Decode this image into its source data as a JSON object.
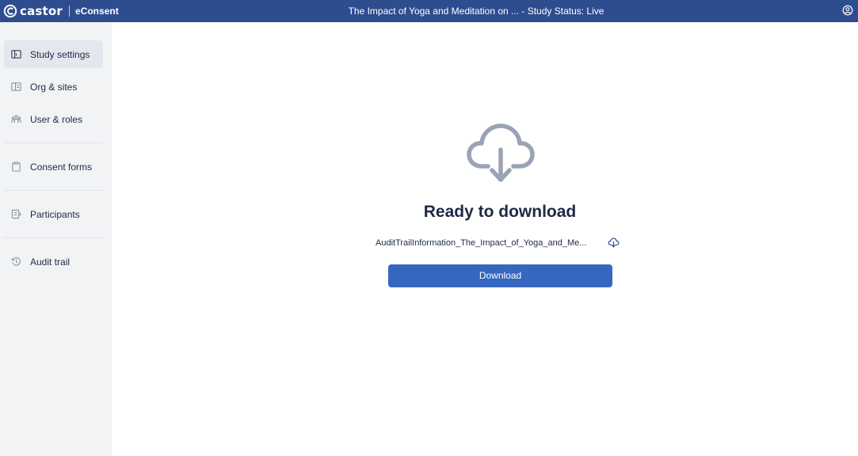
{
  "topbar": {
    "brand_name": "castor",
    "product_name": "eConsent",
    "title": "The Impact of Yoga and Meditation on ...  - Study Status: Live",
    "account_icon": "account-circle-icon"
  },
  "sidebar": {
    "items": [
      {
        "label": "Study settings",
        "icon": "settings-panel-icon",
        "active": true
      },
      {
        "label": "Org & sites",
        "icon": "building-icon",
        "active": false
      },
      {
        "label": "User & roles",
        "icon": "users-icon",
        "active": false
      },
      {
        "label": "Consent forms",
        "icon": "clipboard-icon",
        "active": false
      },
      {
        "label": "Participants",
        "icon": "participants-icon",
        "active": false
      },
      {
        "label": "Audit trail",
        "icon": "history-icon",
        "active": false
      }
    ]
  },
  "main": {
    "icon": "cloud-download-icon",
    "title": "Ready to download",
    "file_name": "AuditTrailInformation_The_Impact_of_Yoga_and_Me...",
    "file_icon": "cloud-download-icon",
    "download_label": "Download"
  },
  "colors": {
    "header": "#2e4d8f",
    "sidebar": "#f2f3f5",
    "accent": "#3566c0",
    "text": "#1d2a45",
    "icon_gray": "#9aa3b5"
  }
}
